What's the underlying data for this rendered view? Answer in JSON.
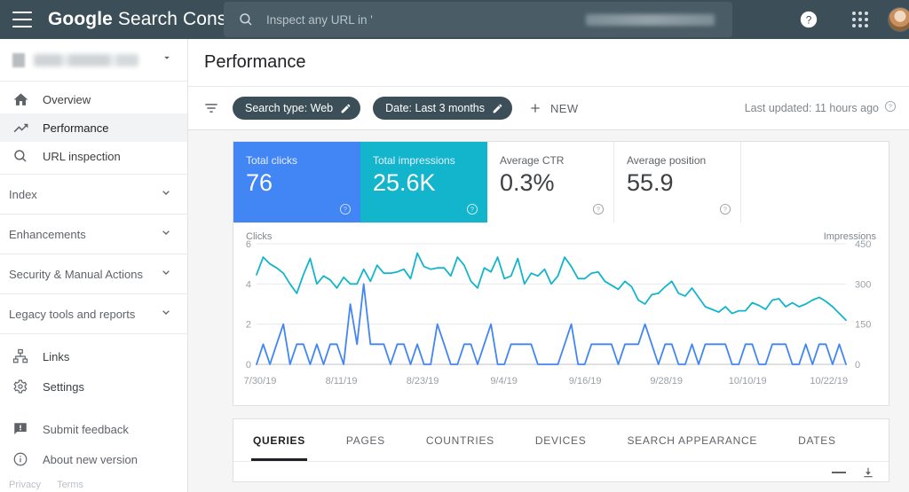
{
  "appbar": {
    "brand_bold": "Google",
    "brand_light": " Search Console",
    "menu_icon": "hamburger-menu-icon",
    "search": {
      "placeholder": "Inspect any URL in '",
      "value": "",
      "icon": "search-icon"
    },
    "help_icon": "help-circle-icon",
    "apps_icon": "apps-grid-icon",
    "avatar": "user-avatar"
  },
  "sidebar": {
    "property_selector": {
      "label": "",
      "chevron": "chevron-down-icon"
    },
    "nav_primary": [
      {
        "label": "Overview",
        "icon": "home-icon",
        "selected": false
      },
      {
        "label": "Performance",
        "icon": "trending-up-icon",
        "selected": true
      },
      {
        "label": "URL inspection",
        "icon": "search-icon",
        "selected": false
      }
    ],
    "collapsibles": [
      {
        "label": "Index",
        "chevron": "chevron-down-icon"
      },
      {
        "label": "Enhancements",
        "chevron": "chevron-down-icon"
      },
      {
        "label": "Security & Manual Actions",
        "chevron": "chevron-down-icon"
      },
      {
        "label": "Legacy tools and reports",
        "chevron": "chevron-down-icon"
      }
    ],
    "nav_secondary": [
      {
        "label": "Links",
        "icon": "links-sitemap-icon"
      },
      {
        "label": "Settings",
        "icon": "gear-icon"
      }
    ],
    "nav_tertiary": [
      {
        "label": "Submit feedback",
        "icon": "feedback-icon"
      },
      {
        "label": "About new version",
        "icon": "info-icon"
      }
    ],
    "footer": [
      {
        "label": "Privacy"
      },
      {
        "label": "Terms"
      }
    ]
  },
  "header": {
    "title": "Performance",
    "filter_icon": "filter-list-icon",
    "chips": [
      {
        "label": "Search type: Web",
        "edit_icon": "pencil-icon"
      },
      {
        "label": "Date: Last 3 months",
        "edit_icon": "pencil-icon"
      }
    ],
    "new_button": {
      "label": "NEW",
      "icon": "plus-icon"
    },
    "last_updated": {
      "text": "Last updated: 11 hours ago",
      "icon": "help-circle-icon"
    }
  },
  "metrics": [
    {
      "label": "Total clicks",
      "value": "76",
      "active": true,
      "color": "#4285f4",
      "help_icon": "help-circle-icon"
    },
    {
      "label": "Total impressions",
      "value": "25.6K",
      "active": true,
      "color": "#12b5cb",
      "help_icon": "help-circle-icon"
    },
    {
      "label": "Average CTR",
      "value": "0.3%",
      "active": false,
      "color": "#ffffff",
      "help_icon": "help-circle-icon"
    },
    {
      "label": "Average position",
      "value": "55.9",
      "active": false,
      "color": "#ffffff",
      "help_icon": "help-circle-icon"
    }
  ],
  "tabs": [
    {
      "label": "QUERIES",
      "active": true
    },
    {
      "label": "PAGES",
      "active": false
    },
    {
      "label": "COUNTRIES",
      "active": false
    },
    {
      "label": "DEVICES",
      "active": false
    },
    {
      "label": "SEARCH APPEARANCE",
      "active": false
    },
    {
      "label": "DATES",
      "active": false
    }
  ],
  "table_toolbar": {
    "collapse_icon": "minus-icon",
    "download_icon": "download-icon"
  },
  "chart_data": {
    "type": "line",
    "title": "",
    "ylabel": "Clicks",
    "y2label": "Impressions",
    "xlabel": "",
    "ylim": [
      0,
      6
    ],
    "y2lim": [
      0,
      450
    ],
    "yticks": [
      "0",
      "2",
      "4",
      "6"
    ],
    "y2ticks": [
      "0",
      "150",
      "300",
      "450"
    ],
    "xticks": [
      "7/30/19",
      "8/11/19",
      "8/23/19",
      "9/4/19",
      "9/16/19",
      "9/28/19",
      "10/10/19",
      "10/22/19"
    ],
    "grid": true,
    "legend": "none",
    "series": [
      {
        "name": "Clicks",
        "color": "#4285f4",
        "axis": "left",
        "values": [
          0,
          1,
          0,
          1,
          2,
          0,
          1,
          1,
          0,
          1,
          0,
          1,
          1,
          0,
          3,
          1,
          4,
          1,
          1,
          1,
          0,
          1,
          1,
          0,
          1,
          0,
          0,
          2,
          1,
          0,
          0,
          1,
          1,
          0,
          1,
          2,
          0,
          0,
          1,
          1,
          1,
          1,
          0,
          0,
          0,
          0,
          1,
          2,
          0,
          0,
          1,
          1,
          1,
          1,
          0,
          1,
          1,
          1,
          2,
          1,
          0,
          1,
          1,
          0,
          0,
          1,
          0,
          1,
          1,
          1,
          1,
          0,
          0,
          1,
          1,
          0,
          0,
          1,
          1,
          1,
          0,
          0,
          1,
          0,
          1,
          1,
          0,
          1,
          0
        ]
      },
      {
        "name": "Impressions",
        "color": "#12b5cb",
        "axis": "right",
        "values": [
          335,
          400,
          375,
          360,
          340,
          300,
          265,
          335,
          395,
          300,
          330,
          315,
          285,
          325,
          300,
          300,
          355,
          310,
          370,
          340,
          340,
          345,
          355,
          320,
          415,
          365,
          355,
          360,
          360,
          330,
          400,
          370,
          310,
          285,
          360,
          345,
          400,
          320,
          330,
          395,
          300,
          340,
          330,
          355,
          300,
          330,
          400,
          365,
          320,
          320,
          340,
          345,
          310,
          295,
          280,
          310,
          290,
          240,
          225,
          260,
          265,
          290,
          310,
          265,
          255,
          285,
          250,
          215,
          205,
          195,
          215,
          190,
          200,
          200,
          230,
          220,
          205,
          240,
          245,
          215,
          230,
          215,
          225,
          240,
          250,
          235,
          215,
          190,
          165
        ]
      }
    ]
  }
}
